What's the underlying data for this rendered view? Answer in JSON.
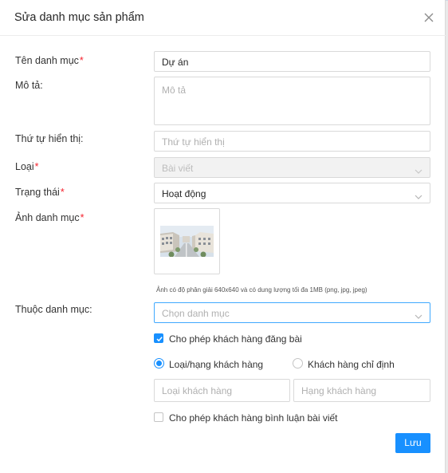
{
  "dialog": {
    "title": "Sửa danh mục sản phẩm"
  },
  "form": {
    "name": {
      "label": "Tên danh mục",
      "required": "*",
      "value": "Dự án"
    },
    "description": {
      "label": "Mô tả:",
      "placeholder": "Mô tả"
    },
    "order": {
      "label": "Thứ tự hiển thị:",
      "placeholder": "Thứ tự hiển thị"
    },
    "type": {
      "label": "Loại",
      "required": "*",
      "value": "Bài viết"
    },
    "status": {
      "label": "Trạng thái",
      "required": "*",
      "value": "Hoạt động"
    },
    "image": {
      "label": "Ảnh danh mục",
      "required": "*",
      "hint": "Ảnh có độ phân giải 640x640 và có dung lượng tối đa 1MB (png, jpg, jpeg)"
    },
    "parent": {
      "label": "Thuộc danh mục:",
      "placeholder": "Chọn danh mục"
    },
    "allow_post": {
      "label": "Cho phép khách hàng đăng bài",
      "checked": true
    },
    "customer_scope": {
      "options": [
        {
          "label": "Loại/hạng khách hàng",
          "selected": true
        },
        {
          "label": "Khách hàng chỉ định",
          "selected": false
        }
      ]
    },
    "customer_type": {
      "placeholder": "Loại khách hàng"
    },
    "customer_rank": {
      "placeholder": "Hạng khách hàng"
    },
    "allow_comment": {
      "label": "Cho phép khách hàng bình luận bài viết",
      "checked": false
    }
  },
  "actions": {
    "save_label": "Lưu"
  },
  "colors": {
    "primary": "#1890ff",
    "required": "#f5222d",
    "border": "#d9d9d9"
  }
}
